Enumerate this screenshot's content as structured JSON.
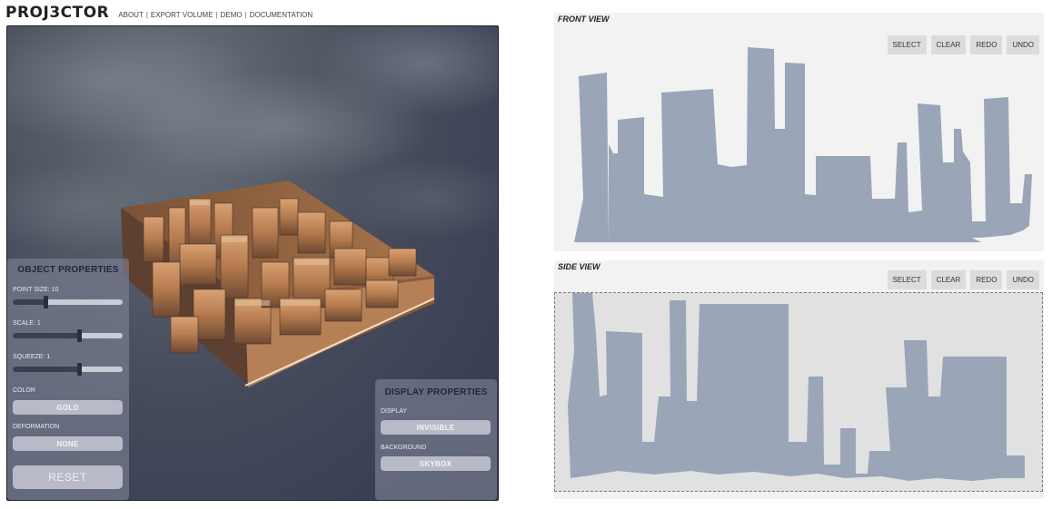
{
  "app": {
    "logo": "PROJ3CTOR"
  },
  "nav": [
    {
      "label": "ABOUT"
    },
    {
      "label": "EXPORT VOLUME"
    },
    {
      "label": "DEMO"
    },
    {
      "label": "DOCUMENTATION"
    }
  ],
  "object_properties": {
    "title": "OBJECT PROPERTIES",
    "point_size": {
      "label": "POINT SIZE: 10",
      "value": 0.3
    },
    "scale": {
      "label": "SCALE: 1",
      "value": 0.6
    },
    "squeeze": {
      "label": "SQUEEZE: 1",
      "value": 0.6
    },
    "color": {
      "label": "COLOR",
      "value": "GOLD"
    },
    "deformation": {
      "label": "DEFORMATION",
      "value": "NONE"
    },
    "reset_label": "RESET"
  },
  "display_properties": {
    "title": "DISPLAY PROPERTIES",
    "display": {
      "label": "DISPLAY",
      "value": "INVISIBLE"
    },
    "background": {
      "label": "BACKGROUND",
      "value": "SKYBOX"
    }
  },
  "front_view": {
    "title": "FRONT VIEW",
    "buttons": {
      "select": "SELECT",
      "clear": "CLEAR",
      "redo": "REDO",
      "undo": "UNDO"
    }
  },
  "side_view": {
    "title": "SIDE VIEW",
    "buttons": {
      "select": "SELECT",
      "clear": "CLEAR",
      "redo": "REDO",
      "undo": "UNDO"
    }
  },
  "colors": {
    "silhouette": "#9aa6b8",
    "gold": "#c98a55",
    "panel_text": "#22283a"
  }
}
